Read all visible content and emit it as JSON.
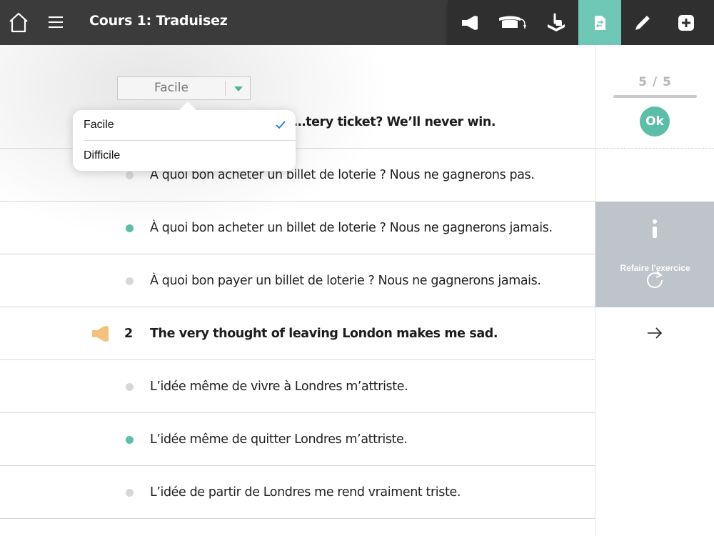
{
  "header": {
    "title": "Cours 1: Traduisez"
  },
  "toolbar": {
    "active_tool": "translate-icon",
    "accent": "#6fc8b5",
    "tools": [
      "megaphone-icon",
      "graduation-cap-icon",
      "hand-pointer-icon",
      "translate-icon",
      "pen-icon",
      "plus-icon"
    ]
  },
  "difficulty": {
    "selected": "Facile",
    "options": [
      "Facile",
      "Difficile"
    ]
  },
  "exercise": {
    "q1_text": "…tery ticket? We’ll never win.",
    "q1_choices": [
      {
        "text": "À quoi bon acheter un billet de loterie ? Nous ne gagnerons pas.",
        "correct": false
      },
      {
        "text": "À quoi bon acheter un billet de loterie ? Nous ne gagnerons jamais.",
        "correct": true
      },
      {
        "text": "À quoi bon payer un billet de loterie ? Nous ne gagnerons jamais.",
        "correct": false
      }
    ],
    "q2_number": "2",
    "q2_text": "The very thought of leaving London makes me sad.",
    "q2_choices": [
      {
        "text": "L’idée même de vivre à Londres m’attriste.",
        "correct": false
      },
      {
        "text": "L’idée même de quitter Londres m’attriste.",
        "correct": true
      },
      {
        "text": "L’idée de partir de Londres me rend vraiment triste.",
        "correct": false
      }
    ]
  },
  "side": {
    "score": "5 / 5",
    "progress": 1.0,
    "ok_label": "Ok",
    "redo_label": "Refaire l'exercice"
  },
  "colors": {
    "header_bg": "#3b3b3b",
    "correct": "#5bbfa8",
    "neutral_dot": "#d7d7d7",
    "speaker": "#f2c27a",
    "info_panel": "#bfc3ca"
  }
}
